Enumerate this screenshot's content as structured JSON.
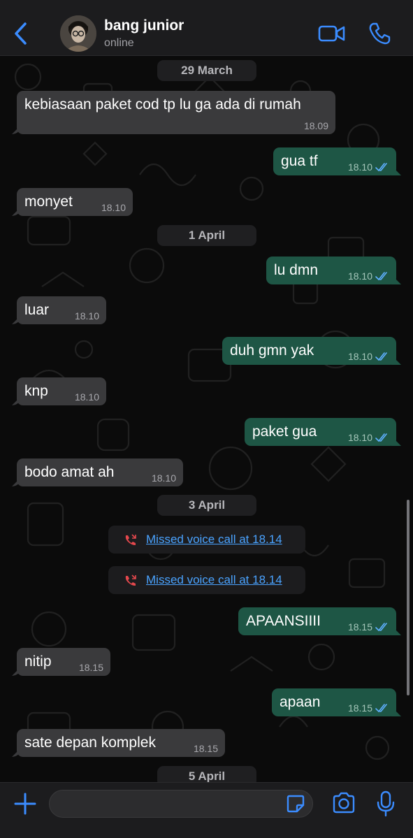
{
  "contact": {
    "name": "bang junior",
    "status": "online"
  },
  "dates": {
    "d1": "29 March",
    "d2": "1 April",
    "d3": "3 April",
    "d4": "5 April"
  },
  "messages": [
    {
      "dir": "in",
      "text": "kebiasaan paket cod tp lu ga ada di rumah",
      "time": "18.09"
    },
    {
      "dir": "out",
      "text": "gua tf",
      "time": "18.10",
      "read": true
    },
    {
      "dir": "in",
      "text": "monyet",
      "time": "18.10"
    },
    {
      "dir": "out",
      "text": "lu dmn",
      "time": "18.10",
      "read": true
    },
    {
      "dir": "in",
      "text": "luar",
      "time": "18.10"
    },
    {
      "dir": "out",
      "text": "duh gmn yak",
      "time": "18.10",
      "read": true
    },
    {
      "dir": "in",
      "text": "knp",
      "time": "18.10"
    },
    {
      "dir": "out",
      "text": "paket gua",
      "time": "18.10",
      "read": true
    },
    {
      "dir": "in",
      "text": "bodo amat ah",
      "time": "18.10"
    },
    {
      "dir": "out",
      "text": "APAANSIIII",
      "time": "18.15",
      "read": true
    },
    {
      "dir": "in",
      "text": "nitip",
      "time": "18.15"
    },
    {
      "dir": "out",
      "text": "apaan",
      "time": "18.15",
      "read": true
    },
    {
      "dir": "in",
      "text": "sate depan komplek",
      "time": "18.15"
    }
  ],
  "calls": [
    {
      "label": "Missed voice call at 18.14"
    },
    {
      "label": "Missed voice call at 18.14"
    }
  ],
  "colors": {
    "incoming": "#3a3a3c",
    "outgoing": "#1e5645",
    "link": "#4aa3ff",
    "accent": "#3b8cff",
    "missed": "#e5484d"
  },
  "icons": [
    "back-chevron-icon",
    "video-call-icon",
    "phone-call-icon",
    "missed-call-icon",
    "plus-icon",
    "sticker-icon",
    "camera-icon",
    "microphone-icon",
    "double-check-icon"
  ]
}
